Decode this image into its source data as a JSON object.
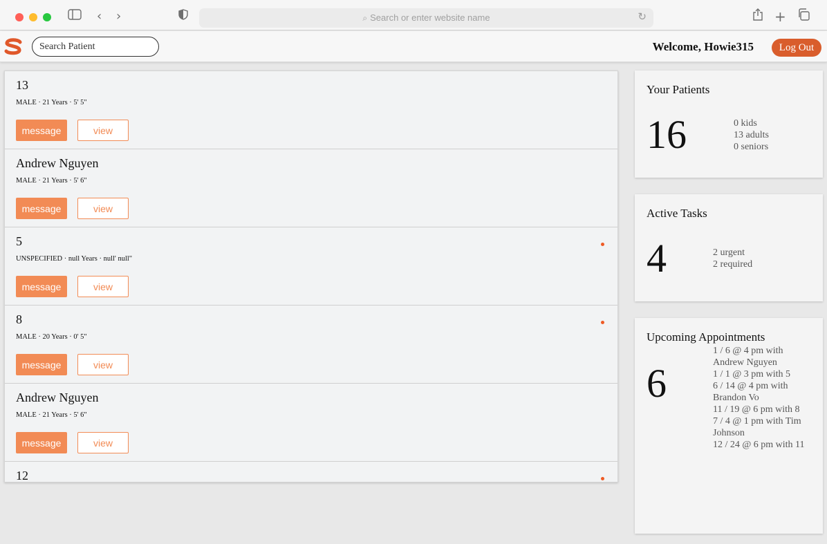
{
  "browser": {
    "address_placeholder": "Search or enter website name"
  },
  "app": {
    "logo_letter": "S",
    "search_placeholder": "Search Patient",
    "welcome": "Welcome, Howie315",
    "logout_label": "Log Out",
    "accent_color": "#d95d2c",
    "button_color": "#f28b55"
  },
  "patients": [
    {
      "name": "13",
      "meta": "MALE  ·  21 Years  ·  5' 5\"",
      "unread": false,
      "message_label": "message",
      "view_label": "view"
    },
    {
      "name": "Andrew Nguyen",
      "meta": "MALE  ·  21 Years  ·  5' 6\"",
      "unread": false,
      "message_label": "message",
      "view_label": "view"
    },
    {
      "name": "5",
      "meta": "UNSPECIFIED  ·  null Years  ·  null' null\"",
      "unread": true,
      "message_label": "message",
      "view_label": "view"
    },
    {
      "name": "8",
      "meta": "MALE  ·  20 Years  ·  0' 5\"",
      "unread": true,
      "message_label": "message",
      "view_label": "view"
    },
    {
      "name": "Andrew Nguyen",
      "meta": "MALE  ·  21 Years  ·  5' 6\"",
      "unread": false,
      "message_label": "message",
      "view_label": "view"
    },
    {
      "name": "12",
      "meta": "",
      "unread": true,
      "message_label": "",
      "view_label": ""
    }
  ],
  "your_patients": {
    "title": "Your Patients",
    "count": "16",
    "kids": "0 kids",
    "adults": "13 adults",
    "seniors": "0 seniors"
  },
  "active_tasks": {
    "title": "Active Tasks",
    "count": "4",
    "urgent": "2 urgent",
    "required": "2 required"
  },
  "appointments": {
    "title": "Upcoming Appointments",
    "count": "6",
    "lines": [
      "1 / 6 @ 4 pm with",
      "Andrew Nguyen",
      "1 / 1 @ 3 pm with 5",
      "6 / 14 @ 4 pm with",
      "Brandon Vo",
      "11 / 19 @ 6 pm with 8",
      "7 / 4 @ 1 pm with Tim",
      "Johnson",
      "12 / 24 @ 6 pm with 11"
    ]
  }
}
